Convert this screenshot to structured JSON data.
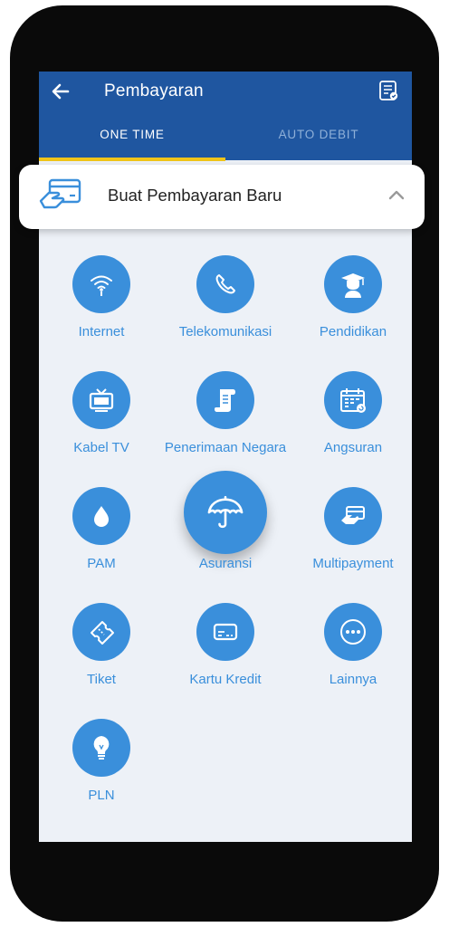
{
  "header": {
    "title": "Pembayaran",
    "back_icon": "arrow-left-icon",
    "history_icon": "receipt-list-icon"
  },
  "tabs": [
    {
      "label": "ONE TIME",
      "selected": true
    },
    {
      "label": "AUTO DEBIT",
      "selected": false
    }
  ],
  "new_payment": {
    "label": "Buat Pembayaran Baru",
    "icon": "card-hand-icon",
    "chevron": "chevron-up-icon",
    "expanded": true
  },
  "categories": [
    {
      "label": "Internet",
      "icon": "wifi-icon"
    },
    {
      "label": "Telekomunikasi",
      "icon": "phone-icon"
    },
    {
      "label": "Pendidikan",
      "icon": "graduate-icon"
    },
    {
      "label": "Kabel TV",
      "icon": "tv-icon"
    },
    {
      "label": "Penerimaan Negara",
      "icon": "scroll-icon"
    },
    {
      "label": "Angsuran",
      "icon": "calendar-icon"
    },
    {
      "label": "PAM",
      "icon": "water-drop-icon"
    },
    {
      "label": "Asuransi",
      "icon": "umbrella-icon",
      "pressed": true
    },
    {
      "label": "Multipayment",
      "icon": "multipayment-icon"
    },
    {
      "label": "Tiket",
      "icon": "ticket-icon"
    },
    {
      "label": "Kartu Kredit",
      "icon": "credit-card-icon"
    },
    {
      "label": "Lainnya",
      "icon": "more-icon"
    },
    {
      "label": "PLN",
      "icon": "light-bulb-icon"
    }
  ],
  "colors": {
    "header": "#1f56a0",
    "accent": "#3a8fdb",
    "tab_indicator": "#f0c419",
    "background": "#edf1f7"
  }
}
